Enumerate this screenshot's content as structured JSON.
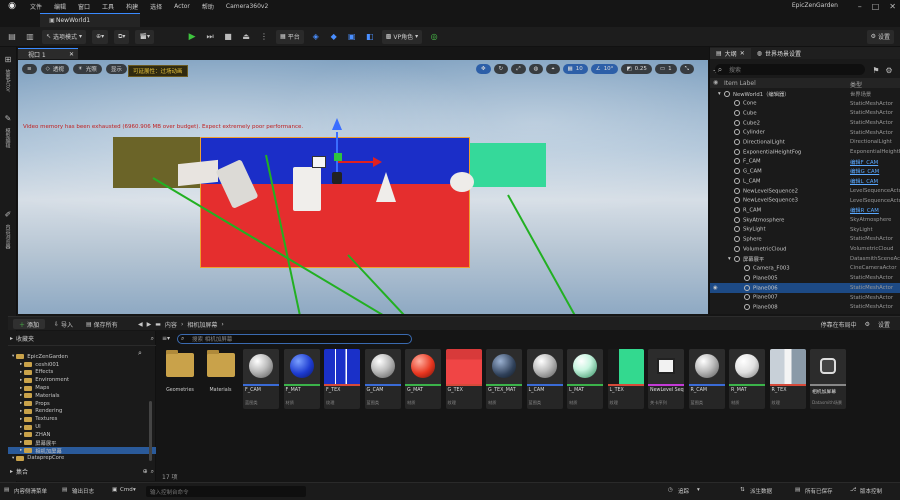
{
  "window": {
    "app_name": "EpicZenGarden",
    "doc_tab": "NewWorld1",
    "menu": [
      "文件",
      "编辑",
      "窗口",
      "工具",
      "构建",
      "选择",
      "Actor",
      "帮助",
      "Camera360v2"
    ]
  },
  "toolbar": {
    "mode_label": "选项模式",
    "platform_label": "平台",
    "vp_label": "VP角色",
    "settings_label": "设置"
  },
  "left_strip": {
    "items": [
      "放置Actor",
      "模型编辑",
      "内容浏览器"
    ]
  },
  "viewport": {
    "tab_label": "视口 1",
    "perspective_label": "透视",
    "lit_label": "光照",
    "show_label": "显示",
    "stat_tag": "可延展性：过场动画",
    "warning": "Video memory has been exhausted (6960.906 MB over budget). Expect extremely poor performance.",
    "grid_value": "10",
    "angle_value": "10°",
    "scale_value": "0.25",
    "speed_value": "1"
  },
  "outliner": {
    "tab_label": "大纲",
    "world_settings_label": "世界场景设置",
    "search_placeholder": "搜索",
    "col_label": "Item Label",
    "col_type": "类型",
    "rows": [
      {
        "label": "NewWorld1（编辑器）",
        "type": "世界场景",
        "indent": 0,
        "link": false
      },
      {
        "label": "Cone",
        "type": "StaticMeshActor",
        "indent": 1,
        "link": false
      },
      {
        "label": "Cube",
        "type": "StaticMeshActor",
        "indent": 1,
        "link": false
      },
      {
        "label": "Cube2",
        "type": "StaticMeshActor",
        "indent": 1,
        "link": false
      },
      {
        "label": "Cylinder",
        "type": "StaticMeshActor",
        "indent": 1,
        "link": false
      },
      {
        "label": "DirectionalLight",
        "type": "DirectionalLight",
        "indent": 1,
        "link": false
      },
      {
        "label": "ExponentialHeightFog",
        "type": "ExponentialHeightFog",
        "indent": 1,
        "link": false
      },
      {
        "label": "F_CAM",
        "type": "编辑F_CAM",
        "indent": 1,
        "link": true
      },
      {
        "label": "G_CAM",
        "type": "编辑G_CAM",
        "indent": 1,
        "link": true
      },
      {
        "label": "L_CAM",
        "type": "编辑L_CAM",
        "indent": 1,
        "link": true
      },
      {
        "label": "NewLevelSequence2",
        "type": "LevelSequenceActor",
        "indent": 1,
        "link": false
      },
      {
        "label": "NewLevelSequence3",
        "type": "LevelSequenceActor",
        "indent": 1,
        "link": false
      },
      {
        "label": "R_CAM",
        "type": "编辑R_CAM",
        "indent": 1,
        "link": true
      },
      {
        "label": "SkyAtmosphere",
        "type": "SkyAtmosphere",
        "indent": 1,
        "link": false
      },
      {
        "label": "SkyLight",
        "type": "SkyLight",
        "indent": 1,
        "link": false
      },
      {
        "label": "Sphere",
        "type": "StaticMeshActor",
        "indent": 1,
        "link": false
      },
      {
        "label": "VolumetricCloud",
        "type": "VolumetricCloud",
        "indent": 1,
        "link": false
      },
      {
        "label": "屏幕展平",
        "type": "DatasmithSceneActor",
        "indent": 1,
        "link": false
      },
      {
        "label": "Camera_F003",
        "type": "CineCameraActor",
        "indent": 2,
        "link": false
      },
      {
        "label": "Plane005",
        "type": "StaticMeshActor",
        "indent": 2,
        "link": false
      },
      {
        "label": "Plane006",
        "type": "StaticMeshActor",
        "indent": 2,
        "link": false,
        "selected": true
      },
      {
        "label": "Plane007",
        "type": "StaticMeshActor",
        "indent": 2,
        "link": false
      },
      {
        "label": "Plane008",
        "type": "StaticMeshActor",
        "indent": 2,
        "link": false
      }
    ]
  },
  "content_drawer": {
    "add_label": "添加",
    "import_label": "导入",
    "save_all_label": "保存所有",
    "path_root": "内容",
    "path_leaf": "相机加屏幕",
    "dock_label": "停靠在布局中",
    "settings_label": "设置",
    "favorites_label": "收藏夹",
    "collections_label": "集合",
    "search_placeholder": "搜索 相机加屏幕",
    "item_count": "17 项",
    "tree": [
      {
        "label": "EpicZenGarden",
        "indent": 0
      },
      {
        "label": "ceshi001",
        "indent": 1
      },
      {
        "label": "Effects",
        "indent": 1
      },
      {
        "label": "Environment",
        "indent": 1
      },
      {
        "label": "Maps",
        "indent": 1
      },
      {
        "label": "Materials",
        "indent": 1
      },
      {
        "label": "Props",
        "indent": 1
      },
      {
        "label": "Rendering",
        "indent": 1
      },
      {
        "label": "Textures",
        "indent": 1
      },
      {
        "label": "UI",
        "indent": 1
      },
      {
        "label": "ZHAN",
        "indent": 1
      },
      {
        "label": "屏幕展平",
        "indent": 1
      },
      {
        "label": "相机加屏幕",
        "indent": 1,
        "selected": true
      },
      {
        "label": "DataprepCore",
        "indent": 0
      }
    ],
    "assets": [
      {
        "name": "Geometries",
        "type": "",
        "kind": "folder"
      },
      {
        "name": "Materials",
        "type": "",
        "kind": "folder"
      },
      {
        "name": "F_CAM",
        "type": "蓝图类",
        "kind": "blueprint",
        "bar": "#3a6bd6"
      },
      {
        "name": "F_MAT",
        "type": "材质",
        "kind": "mat-blue",
        "bar": "#3bb34a"
      },
      {
        "name": "F_TEX",
        "type": "纹理",
        "kind": "tex-blue",
        "bar": "#d64a3a"
      },
      {
        "name": "G_CAM",
        "type": "蓝图类",
        "kind": "blueprint",
        "bar": "#3a6bd6"
      },
      {
        "name": "G_MAT",
        "type": "材质",
        "kind": "mat-red",
        "bar": "#3bb34a"
      },
      {
        "name": "G_TEX",
        "type": "纹理",
        "kind": "tex-red",
        "bar": "#d64a3a"
      },
      {
        "name": "G_TEX_MAT",
        "type": "材质",
        "kind": "mat-dark",
        "bar": "#3bb34a"
      },
      {
        "name": "L_CAM",
        "type": "蓝图类",
        "kind": "blueprint",
        "bar": "#3a6bd6"
      },
      {
        "name": "L_MAT",
        "type": "材质",
        "kind": "mat-green",
        "bar": "#3bb34a"
      },
      {
        "name": "L_TEX",
        "type": "纹理",
        "kind": "tex-green",
        "bar": "#d64a3a"
      },
      {
        "name": "NewLevel Sequence2",
        "type": "关卡序列",
        "kind": "sequence",
        "bar": "#c33ad6"
      },
      {
        "name": "R_CAM",
        "type": "蓝图类",
        "kind": "blueprint",
        "bar": "#3a6bd6"
      },
      {
        "name": "R_MAT",
        "type": "材质",
        "kind": "mat-white",
        "bar": "#3bb34a"
      },
      {
        "name": "R_TEX",
        "type": "纹理",
        "kind": "tex-white",
        "bar": "#d64a3a"
      },
      {
        "name": "相机加屏幕",
        "type": "Datasmith场景",
        "kind": "datasmith",
        "bar": "#888888"
      }
    ]
  },
  "status_bar": {
    "content_drawer_label": "内容侧滑菜单",
    "output_log_label": "输出日志",
    "cmd_label": "Cmd",
    "console_placeholder": "输入控制台命令",
    "trace_label": "追踪",
    "derived_data_label": "派生数据",
    "saved_label": "所有已保存",
    "source_control_label": "版本控制"
  }
}
